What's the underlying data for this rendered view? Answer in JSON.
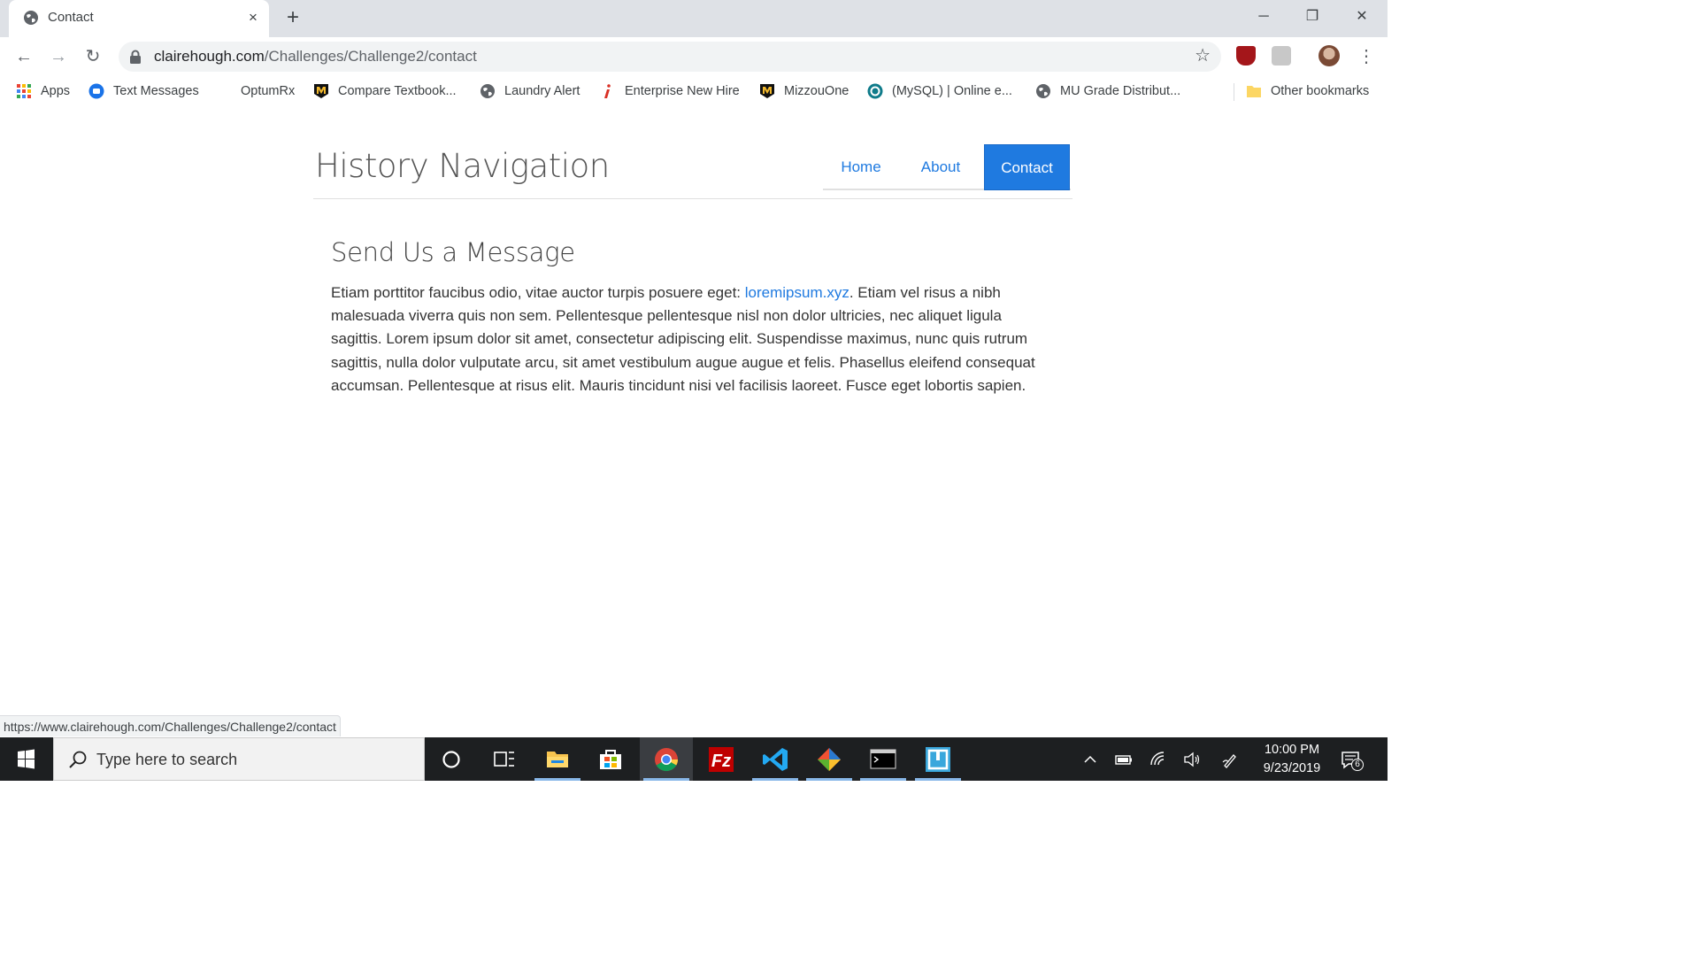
{
  "browser": {
    "tab": {
      "title": "Contact",
      "favicon": "globe-icon",
      "close": "×"
    },
    "new_tab": "+",
    "window_controls": {
      "minimize": "─",
      "restore": "❐",
      "close": "✕"
    },
    "toolbar": {
      "back": "←",
      "forward": "→",
      "reload": "↻",
      "url_host": "clairehough.com",
      "url_path": "/Challenges/Challenge2/contact",
      "star": "☆",
      "menu": "⋮"
    },
    "bookmarks": [
      {
        "label": "Apps",
        "icon": "apps-grid-icon"
      },
      {
        "label": "Text Messages",
        "icon": "messages-icon"
      },
      {
        "label": "OptumRx",
        "icon": "none"
      },
      {
        "label": "Compare Textbook...",
        "icon": "mizzou-icon"
      },
      {
        "label": "Laundry Alert",
        "icon": "globe-icon"
      },
      {
        "label": "Enterprise New Hire",
        "icon": "info-icon"
      },
      {
        "label": "MizzouOne",
        "icon": "mizzou-icon"
      },
      {
        "label": "(MySQL) | Online e...",
        "icon": "circle-logo-icon"
      },
      {
        "label": "MU Grade Distribut...",
        "icon": "globe-icon"
      }
    ],
    "other_bookmarks": "Other bookmarks",
    "status_url": "https://www.clairehough.com/Challenges/Challenge2/contact"
  },
  "site": {
    "title": "History Navigation",
    "nav": [
      {
        "label": "Home",
        "active": false
      },
      {
        "label": "About",
        "active": false
      },
      {
        "label": "Contact",
        "active": true
      }
    ],
    "heading": "Send Us a Message",
    "body_before_link": "Etiam porttitor faucibus odio, vitae auctor turpis posuere eget: ",
    "link_text": "loremipsum.xyz",
    "body_after_link": ". Etiam vel risus a nibh malesuada viverra quis non sem. Pellentesque pellentesque nisl non dolor ultricies, nec aliquet ligula sagittis. Lorem ipsum dolor sit amet, consectetur adipiscing elit. Suspendisse maximus, nunc quis rutrum sagittis, nulla dolor vulputate arcu, sit amet vestibulum augue augue et felis. Phasellus eleifend consequat accumsan. Pellentesque at risus elit. Mauris tincidunt nisi vel facilisis laoreet. Fusce eget lobortis sapien."
  },
  "taskbar": {
    "search_placeholder": "Type here to search",
    "apps": [
      "cortana-icon",
      "task-view-icon",
      "file-explorer-icon",
      "store-icon",
      "chrome-icon",
      "filezilla-icon",
      "vscode-icon",
      "git-icon",
      "terminal-icon",
      "bracket-app-icon"
    ],
    "clock_time": "10:00 PM",
    "clock_date": "9/23/2019",
    "notification_count": "6",
    "colors": {
      "taskbar": "#1d1f21",
      "accent": "#1f7ae0"
    }
  }
}
